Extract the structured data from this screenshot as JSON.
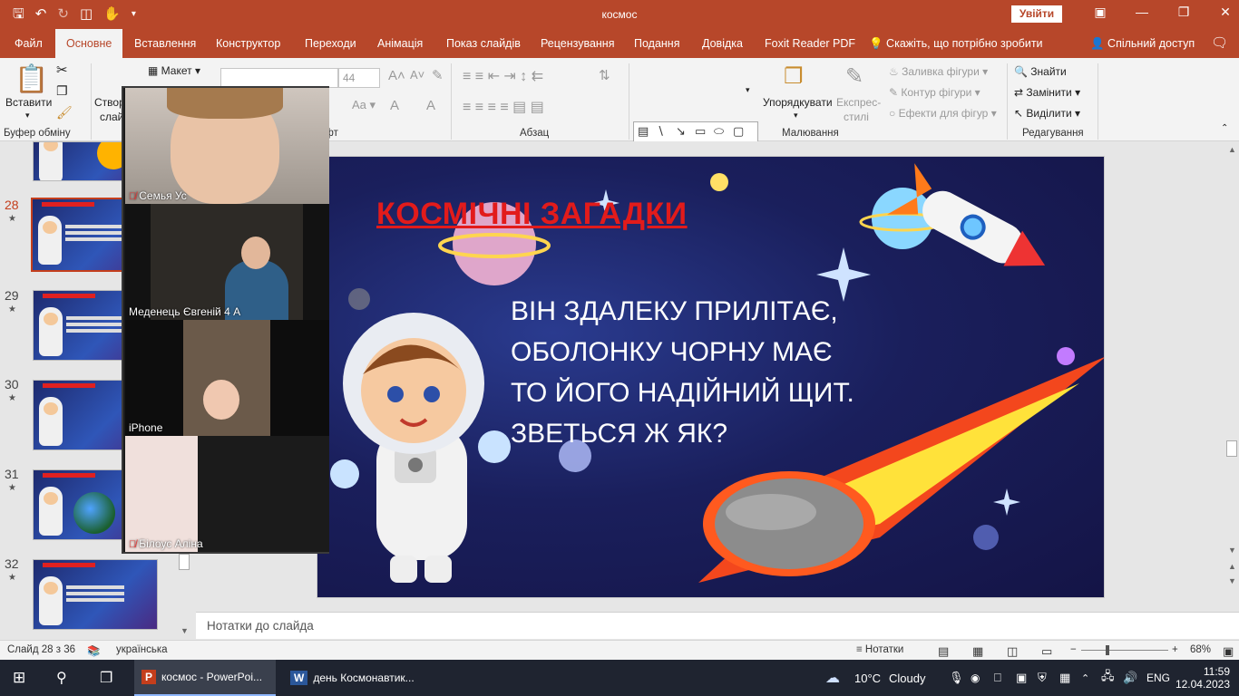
{
  "window": {
    "title": "космос",
    "signin": "Увійти"
  },
  "tabs": [
    "Файл",
    "Основне",
    "Вставлення",
    "Конструктор",
    "Переходи",
    "Анімація",
    "Показ слайдів",
    "Рецензування",
    "Подання",
    "Довідка",
    "Foxit Reader PDF",
    "Скажіть, що потрібно зробити",
    "Спільний доступ"
  ],
  "ribbon": {
    "paste": "Вставити",
    "create": "Створ",
    "slides_sub": "слай",
    "layout": "Макет",
    "font_size": "44",
    "clipboard_label": "Буфер обміну",
    "font_label": "ифт",
    "paragraph_label": "Абзац",
    "drawing_label": "Малювання",
    "editing_label": "Редагування",
    "arrange": "Упорядкувати",
    "express_styles_1": "Експрес-",
    "express_styles_2": "стилі",
    "shape_fill": "Заливка фігури",
    "shape_outline": "Контур фігури",
    "shape_effects": "Ефекти для фігур",
    "find": "Знайти",
    "replace": "Замінити",
    "select": "Виділити"
  },
  "thumbnails": [
    {
      "num": "28"
    },
    {
      "num": "29"
    },
    {
      "num": "30"
    },
    {
      "num": "31"
    },
    {
      "num": "32"
    }
  ],
  "slide": {
    "title": "КОСМІЧНІ ЗАГАДКИ",
    "lines": [
      "ВІН ЗДАЛЕКУ ПРИЛІТАЄ,",
      "ОБОЛОНКУ ЧОРНУ МАЄ",
      "ТО ЙОГО НАДІЙНИЙ ЩИТ.",
      "ЗВЕТЬСЯ Ж ЯК?"
    ]
  },
  "notes_placeholder": "Нотатки до слайда",
  "video_tiles": [
    {
      "name": "Семья Ус",
      "muted": true
    },
    {
      "name": "Меденець Євгеній 4 А",
      "muted": false
    },
    {
      "name": "iPhone",
      "muted": false
    },
    {
      "name": "Білоус Аліна",
      "muted": true
    }
  ],
  "status": {
    "slide_info": "Слайд 28 з 36",
    "language": "українська",
    "notes": "Нотатки",
    "zoom": "68%"
  },
  "taskbar": {
    "app1": "космос - PowerPoi...",
    "app2": "день Космонавтик...",
    "temp": "10°C",
    "weather": "Cloudy",
    "lang": "ENG",
    "time": "11:59",
    "date": "12.04.2023"
  }
}
